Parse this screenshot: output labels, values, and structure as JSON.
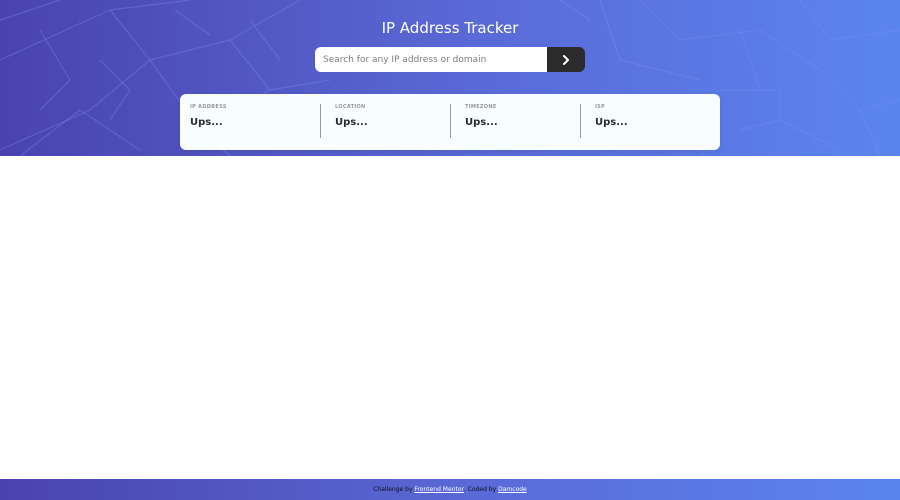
{
  "header": {
    "title": "IP Address Tracker",
    "background_color_start": "#4a43ad",
    "background_color_end": "#5b85ee"
  },
  "search": {
    "placeholder": "Search for any IP address or domain",
    "value": "",
    "button_icon": "chevron-right-icon"
  },
  "info": {
    "items": [
      {
        "label": "IP Address",
        "value": "Ups..."
      },
      {
        "label": "Location",
        "value": "Ups..."
      },
      {
        "label": "Timezone",
        "value": "Ups..."
      },
      {
        "label": "ISP",
        "value": "Ups..."
      }
    ]
  },
  "footer": {
    "challenge_prefix": "Challenge by ",
    "challenge_link": "Frontend Mentor",
    "coded_prefix": ". Coded by ",
    "coded_link": "Damcode"
  }
}
